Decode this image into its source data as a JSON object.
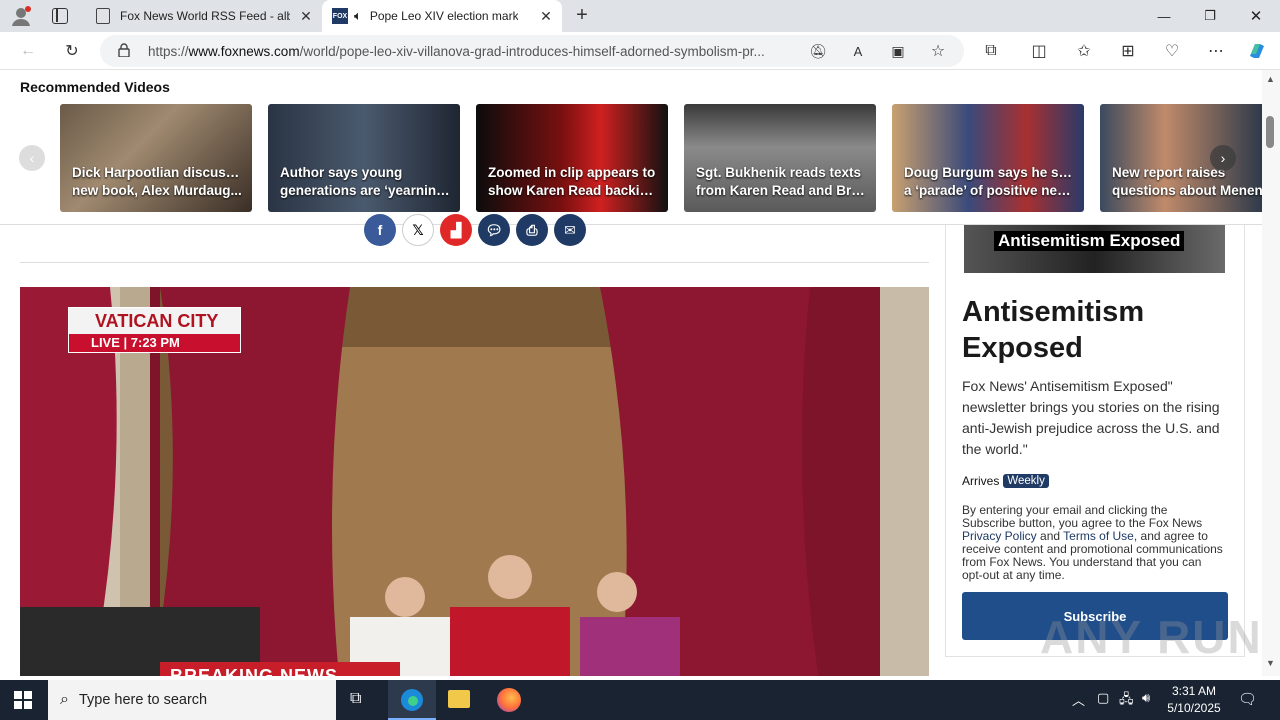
{
  "browser": {
    "tabs": [
      {
        "label": "Fox News World RSS Feed - albe",
        "active": false
      },
      {
        "label": "Pope Leo XIV election mark",
        "active": true
      }
    ],
    "url_prefix": "https://",
    "url_domain": "www.foxnews.com",
    "url_path": "/world/pope-leo-xiv-villanova-grad-introduces-himself-adorned-symbolism-pr..."
  },
  "recommended": {
    "title": "Recommended Videos",
    "videos": [
      {
        "line1": "Dick Harpootlian discusses",
        "line2": "new book, Alex Murdaug..."
      },
      {
        "line1": "Author says young",
        "line2": "generations are ‘yearning..."
      },
      {
        "line1": "Zoomed in clip appears to",
        "line2": "show Karen Read backing..."
      },
      {
        "line1": "Sgt. Bukhenik reads texts",
        "line2": "from Karen Read and Bria..."
      },
      {
        "line1": "Doug Burgum says he sees",
        "line2": "a ‘parade’ of positive new..."
      },
      {
        "line1": "New report raises",
        "line2": "questions about Menend..."
      }
    ]
  },
  "hero": {
    "badge_top": "VATICAN CITY",
    "badge_bottom": "LIVE | 7:23 PM",
    "breaking": "BREAKING NEWS"
  },
  "newsletter": {
    "banner_text": "Antisemitism Exposed",
    "title": "Antisemitism Exposed",
    "description": "Fox News' Antisemitism Exposed\" newsletter brings you stories on the rising anti-Jewish prejudice across the U.S. and the world.\"",
    "arrives_label": "Arrives",
    "frequency": "Weekly",
    "legal_1": "By entering your email and clicking the Subscribe button, you agree to the Fox News ",
    "privacy_link": "Privacy Policy",
    "legal_and": " and ",
    "terms_link": "Terms of Use",
    "legal_2": ", and agree to receive content and promotional communications from Fox News. You understand that you can opt-out at any time.",
    "subscribe_label": "Subscribe"
  },
  "watermark": "ANY RUN",
  "taskbar": {
    "search_placeholder": "Type here to search",
    "time": "3:31 AM",
    "date": "5/10/2025"
  },
  "colors": {
    "fox_blue": "#1f4e8a",
    "hero_red": "#8a1730",
    "taskbar_bg": "#1a2332"
  }
}
